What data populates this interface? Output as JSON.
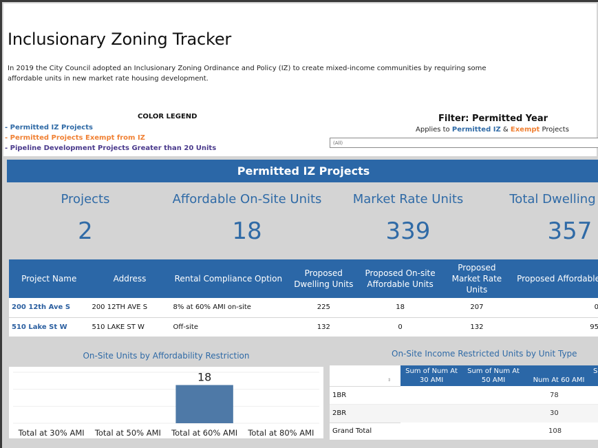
{
  "page": {
    "title": "Inclusionary Zoning Tracker",
    "intro": "In 2019 the City Council adopted an Inclusionary Zoning Ordinance and Policy (IZ) to create mixed-income communities by requiring some affordable units in new market rate housing development."
  },
  "legend": {
    "title": "COLOR LEGEND",
    "items": [
      {
        "label": "- Permitted IZ Projects",
        "color": "#2f6aa6"
      },
      {
        "label": "- Permitted Projects Exempt from IZ",
        "color": "#f08033"
      },
      {
        "label": "- Pipeline Development Projects Greater than 20 Units",
        "color": "#4a3a8c"
      }
    ]
  },
  "filter": {
    "title": "Filter: Permitted Year",
    "sub_prefix": "Applies to ",
    "sub_blue": "Permitted IZ",
    "sub_mid": " & ",
    "sub_orange": "Exempt",
    "sub_suffix": " Projects",
    "selected": "(All)"
  },
  "section": {
    "title": "Permitted IZ Projects"
  },
  "kpis": [
    {
      "label": "Projects",
      "value": "2"
    },
    {
      "label": "Affordable On-Site Units",
      "value": "18"
    },
    {
      "label": "Market Rate Units",
      "value": "339"
    },
    {
      "label": "Total Dwelling",
      "value": "357"
    }
  ],
  "projects_table": {
    "columns": [
      "Project Name",
      "Address",
      "Rental Compliance Option",
      "Proposed Dwelling Units",
      "Proposed On-site Affordable Units",
      "Proposed Market Rate Units",
      "Proposed Affordable"
    ],
    "rows": [
      [
        "200 12th Ave S",
        "200 12TH AVE S",
        "8% at 60% AMI on-site",
        "225",
        "18",
        "207",
        "0"
      ],
      [
        "510 Lake St W",
        "510 LAKE ST W",
        "Off-site",
        "132",
        "0",
        "132",
        "95"
      ]
    ]
  },
  "chart_data": {
    "type": "bar",
    "title": "On-Site Units by Affordability Restriction",
    "categories": [
      "Total at 30% AMI",
      "Total at 50% AMI",
      "Total at 60% AMI",
      "Total at 80% AMI"
    ],
    "values": [
      0,
      0,
      18,
      0
    ],
    "data_labels": [
      "",
      "",
      "18",
      ""
    ],
    "xlabel": "",
    "ylabel": "",
    "ylim": [
      0,
      24
    ],
    "grid": true,
    "bar_color": "#4e79a7"
  },
  "pivot": {
    "title": "On-Site Income Restricted Units by Unit Type",
    "columns": [
      "Sum of Num At 30 AMI",
      "Sum of Num At 50 AMI",
      "Num At 60 AMI",
      "Su"
    ],
    "rows": [
      {
        "label": "1BR",
        "values": [
          "",
          "",
          "78"
        ]
      },
      {
        "label": "2BR",
        "values": [
          "",
          "",
          "30"
        ]
      },
      {
        "label": "Grand Total",
        "values": [
          "",
          "",
          "108"
        ]
      }
    ]
  }
}
